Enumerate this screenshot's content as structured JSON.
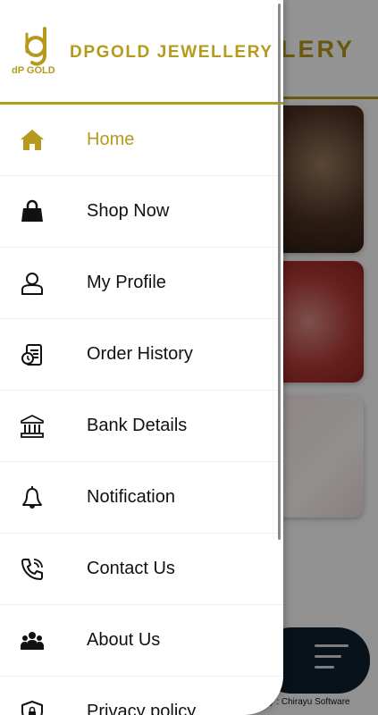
{
  "app": {
    "brand_title": "DPGOLD JEWELLERY",
    "logo_text": "dP GOLD",
    "background_title": "LLERY",
    "footer_text": "by : Chirayu Software"
  },
  "colors": {
    "accent": "#b59a1c",
    "text": "#111111",
    "bottom_bar": "#0f1f2e"
  },
  "drawer": {
    "items": [
      {
        "label": "Home",
        "icon": "home-icon",
        "active": true
      },
      {
        "label": "Shop Now",
        "icon": "shopping-bag-icon",
        "active": false
      },
      {
        "label": "My Profile",
        "icon": "user-icon",
        "active": false
      },
      {
        "label": "Order History",
        "icon": "order-history-icon",
        "active": false
      },
      {
        "label": "Bank Details",
        "icon": "bank-icon",
        "active": false
      },
      {
        "label": "Notification",
        "icon": "bell-icon",
        "active": false
      },
      {
        "label": "Contact Us",
        "icon": "phone-icon",
        "active": false
      },
      {
        "label": "About Us",
        "icon": "group-icon",
        "active": false
      },
      {
        "label": "Privacy policy",
        "icon": "shield-lock-icon",
        "active": false
      }
    ]
  }
}
